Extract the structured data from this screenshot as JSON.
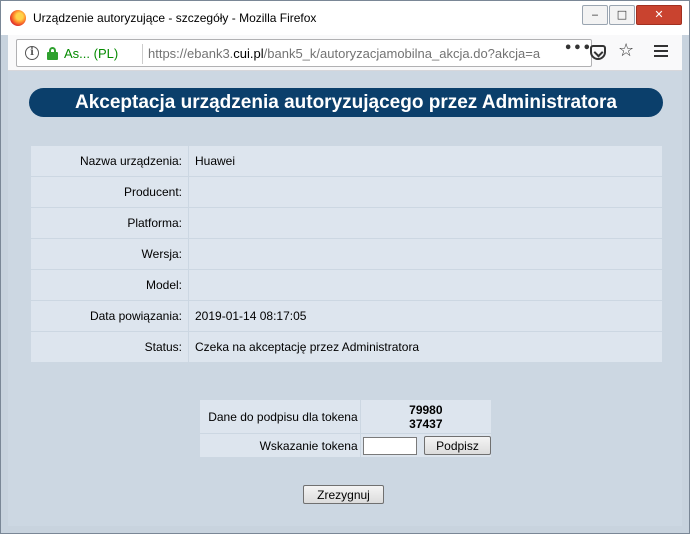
{
  "window": {
    "title": "Urządzenie autoryzujące - szczegóły - Mozilla Firefox",
    "controls": {
      "minimize": "‒",
      "maximize": "□",
      "close": "✕"
    }
  },
  "urlbar": {
    "site_owner": "As... (PL)",
    "url_prefix": "https://ebank3.",
    "url_host": "cui.pl",
    "url_path": "/bank5_k/autoryzacjamobilna_akcja.do?akcja=a",
    "more": "•••",
    "star": "☆"
  },
  "page": {
    "banner_title": "Akceptacja urządzenia autoryzującego przez Administratora",
    "details": [
      {
        "label": "Nazwa urządzenia:",
        "value": "Huawei"
      },
      {
        "label": "Producent:",
        "value": ""
      },
      {
        "label": "Platforma:",
        "value": ""
      },
      {
        "label": "Wersja:",
        "value": ""
      },
      {
        "label": "Model:",
        "value": ""
      },
      {
        "label": "Data powiązania:",
        "value": "2019-01-14 08:17:05"
      },
      {
        "label": "Status:",
        "value": "Czeka na akceptację przez Administratora"
      }
    ],
    "token": {
      "sign_data_label": "Dane do podpisu dla tokena",
      "sign_data_line1": "79980",
      "sign_data_line2": "37437",
      "reading_label": "Wskazanie tokena",
      "reading_value": "",
      "sign_button": "Podpisz"
    },
    "cancel_button": "Zrezygnuj"
  },
  "colors": {
    "banner": "#0b3f6b",
    "content_bg": "#ccd7e2",
    "row_bg": "#dde5ee",
    "secure_green": "#058b00"
  }
}
